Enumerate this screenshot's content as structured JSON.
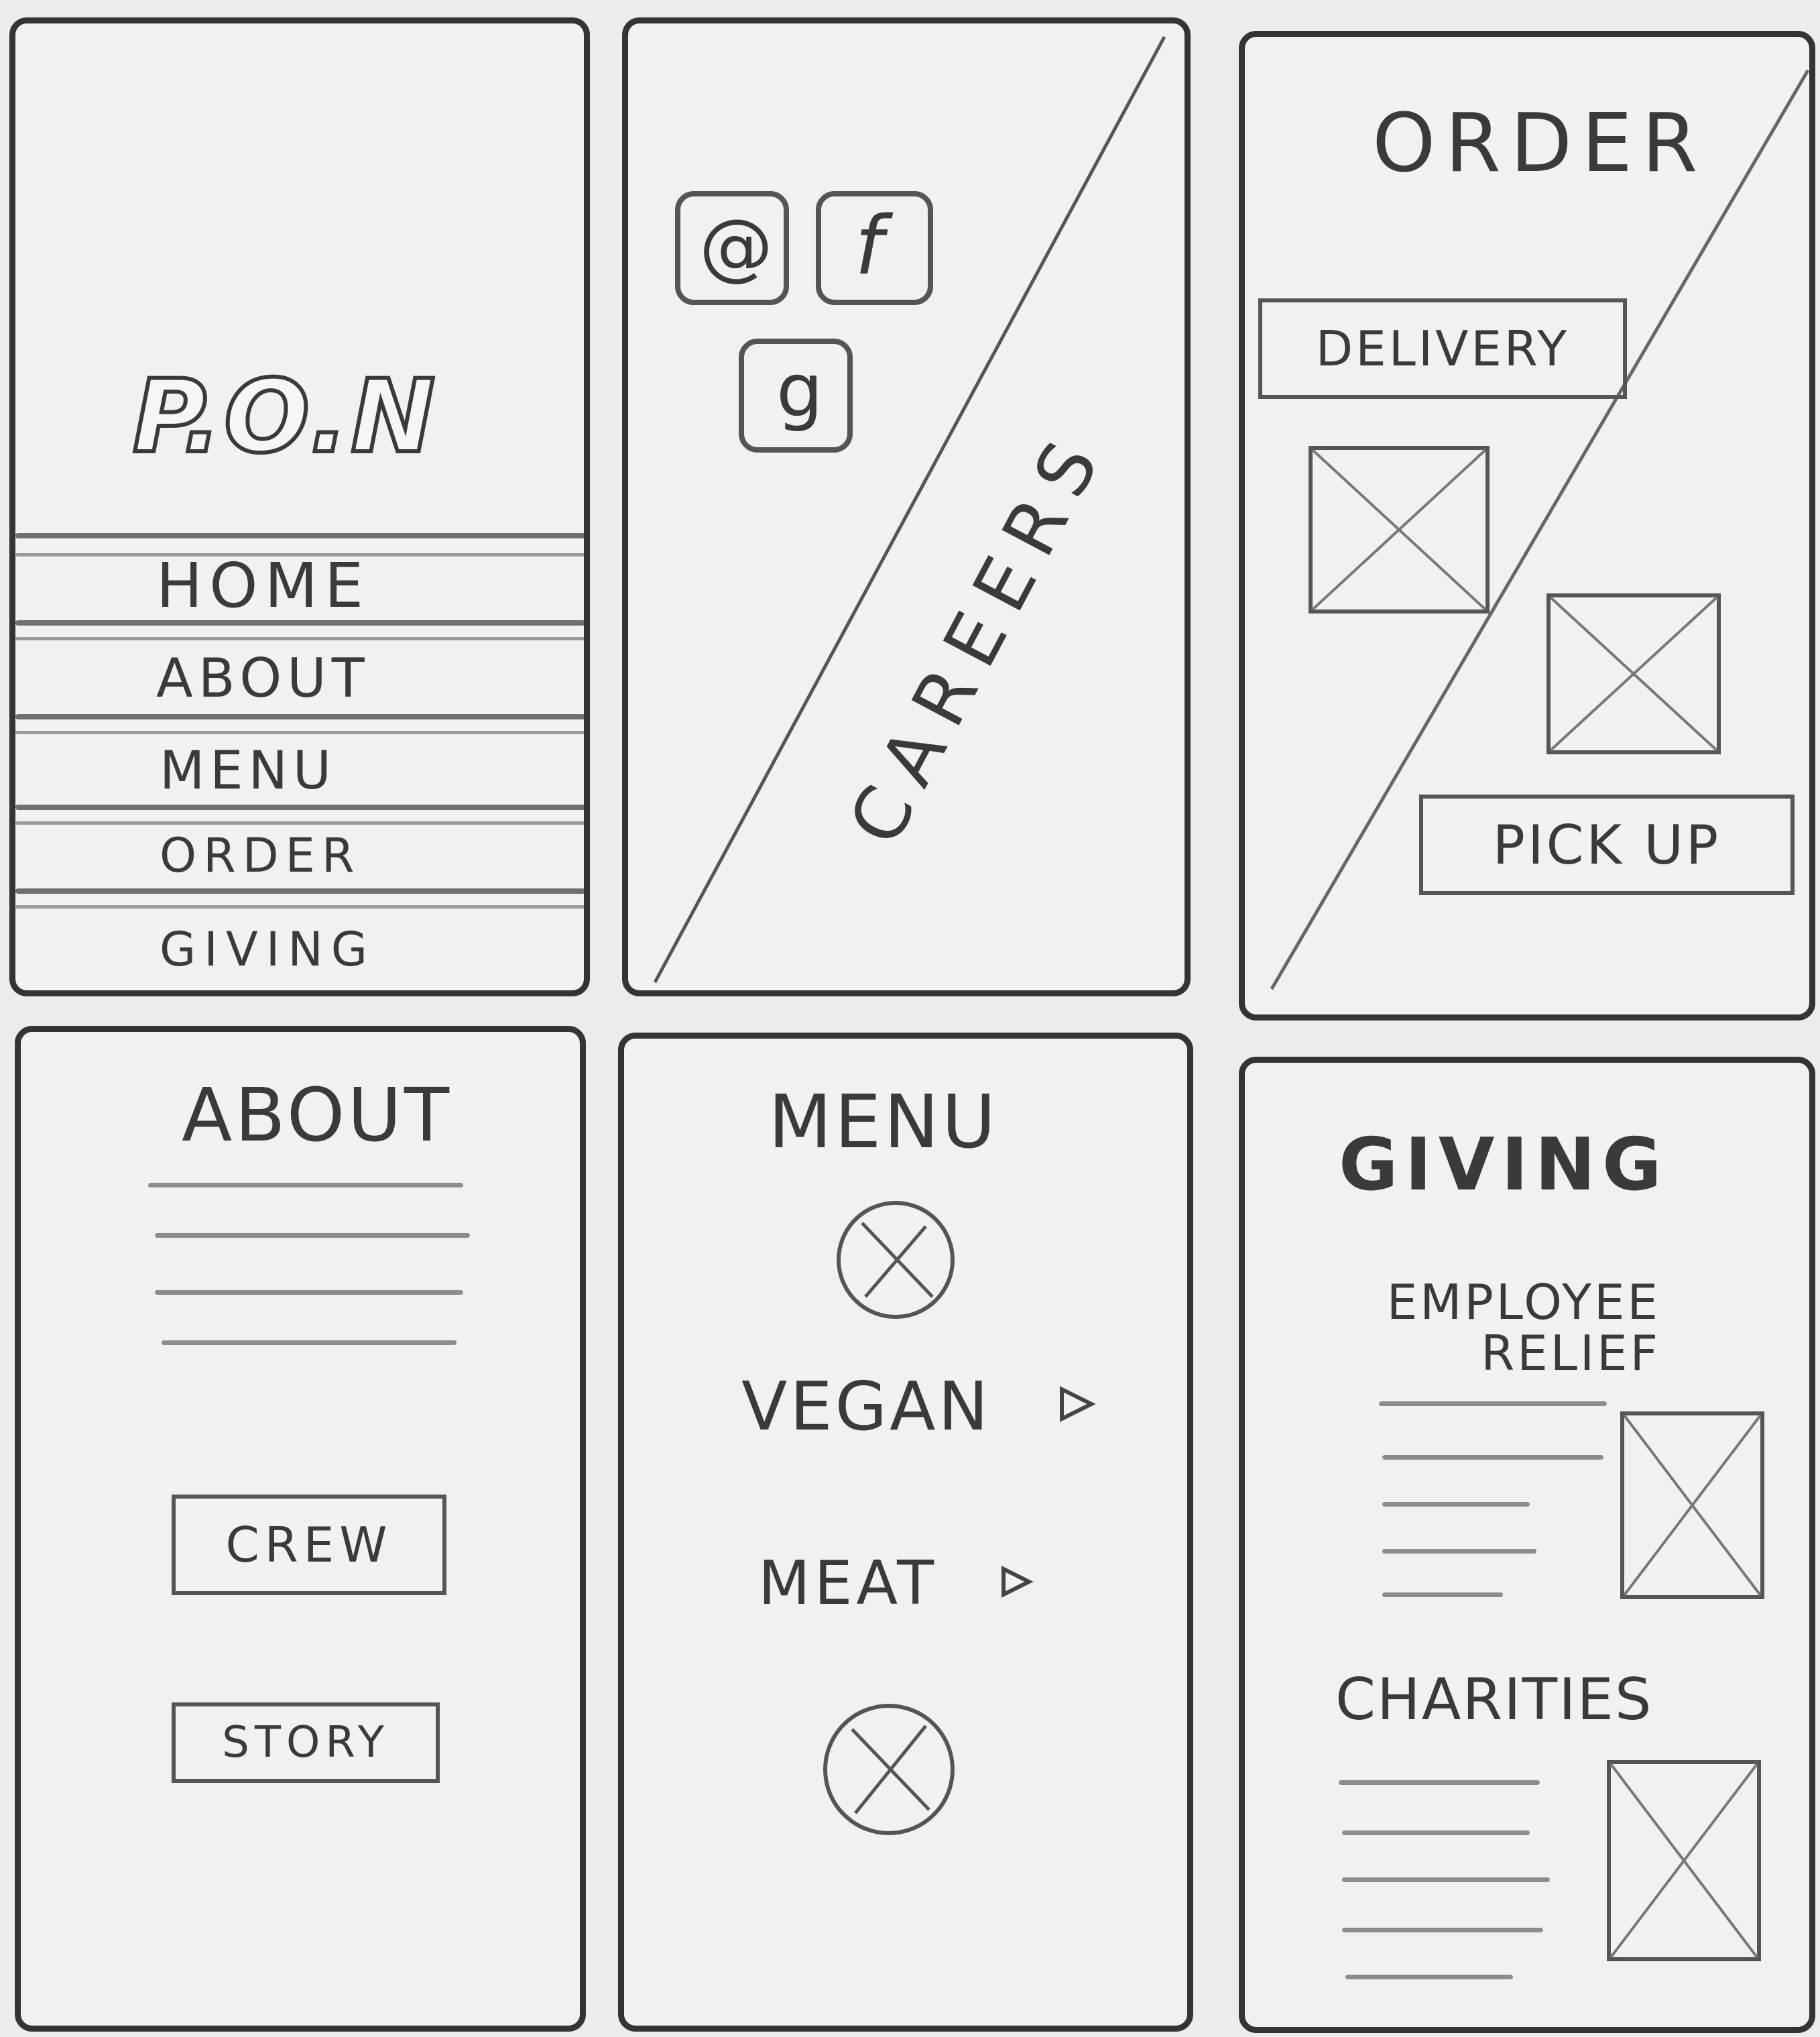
{
  "screens": {
    "home": {
      "logo": "P.O.N",
      "nav": [
        "HOME",
        "ABOUT",
        "MENU",
        "ORDER",
        "GIVING"
      ]
    },
    "social": {
      "icons": [
        "instagram-icon",
        "facebook-icon",
        "google-icon"
      ],
      "instagram_glyph": "@",
      "facebook_glyph": "f",
      "google_glyph": "g",
      "careers": "CAREERS"
    },
    "order": {
      "title": "ORDER",
      "delivery": "DELIVERY",
      "pickup": "PICK UP"
    },
    "about": {
      "title": "ABOUT",
      "crew": "CREW",
      "story": "STORY"
    },
    "menu": {
      "title": "MENU",
      "vegan": "VEGAN",
      "meat": "MEAT"
    },
    "giving": {
      "title": "GIVING",
      "employee_relief": "EMPLOYEE RELIEF",
      "charities": "CHARITIES"
    }
  },
  "colors": {
    "paper": "#ececec",
    "pencil": "#343434"
  }
}
